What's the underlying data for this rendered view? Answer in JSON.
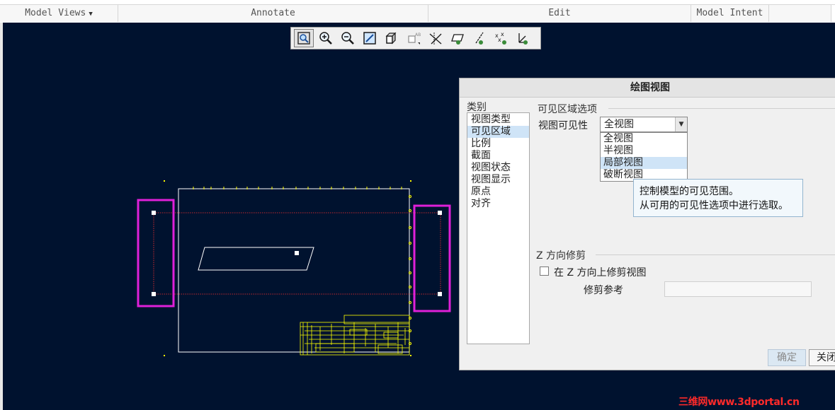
{
  "ribbon": {
    "groups": [
      "Model Views",
      "Annotate",
      "Edit",
      "Model Intent"
    ]
  },
  "toolbar": {
    "icons": [
      "refit-icon",
      "zoom-in-icon",
      "zoom-out-icon",
      "repaint-icon",
      "display-style-icon",
      "view-orientation-icon",
      "datum-display-icon",
      "plane-display-icon",
      "axis-display-icon",
      "point-display-icon",
      "csys-display-icon"
    ]
  },
  "colors": {
    "canvas": "#00122f",
    "drawing": "#ffff00",
    "highlight": "#e020d8",
    "boundary": "#ff3030"
  },
  "dialog": {
    "title": "绘图视图",
    "category_label": "类别",
    "categories": [
      "视图类型",
      "可见区域",
      "比例",
      "截面",
      "视图状态",
      "视图显示",
      "原点",
      "对齐"
    ],
    "visible_area_section": "可见区域选项",
    "visibility_label": "视图可见性",
    "visibility_value": "全视图",
    "visibility_options": [
      "全视图",
      "半视图",
      "局部视图",
      "破断视图"
    ],
    "z_section": "Z 方向修剪",
    "z_clip_label": "在 Z 方向上修剪视图",
    "clip_ref_label": "修剪参考",
    "ok_label": "确定",
    "close_label": "关闭"
  },
  "tooltip": {
    "line1": "控制模型的可见范围。",
    "line2": "从可用的可见性选项中进行选取。"
  },
  "watermark": "三维网www.3dportal.cn"
}
